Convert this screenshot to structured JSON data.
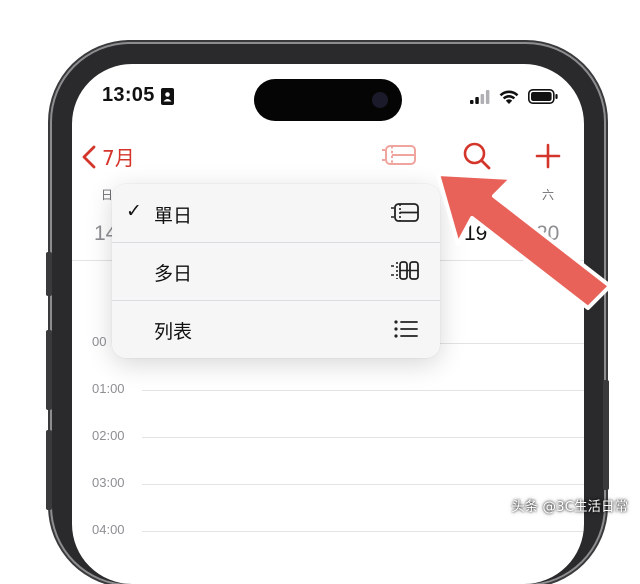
{
  "status_bar": {
    "time": "13:05",
    "icons": [
      "contact-card-icon",
      "signal-icon",
      "wifi-icon",
      "battery-icon"
    ]
  },
  "nav": {
    "back_label": "7月",
    "icons": [
      "day-view-icon",
      "search-icon",
      "plus-icon"
    ],
    "accent_color": "#d4352b"
  },
  "week": {
    "weekday_first": "日",
    "weekday_last": "六",
    "day_first": "14",
    "day_selected": "19",
    "day_last": "20"
  },
  "menu": {
    "items": [
      {
        "label": "單日",
        "checked": true,
        "icon": "single-day-icon"
      },
      {
        "label": "多日",
        "checked": false,
        "icon": "multi-day-icon"
      },
      {
        "label": "列表",
        "checked": false,
        "icon": "list-icon"
      }
    ],
    "check_mark": "✓"
  },
  "timeline": {
    "partial_hour": "00",
    "hours": [
      "01:00",
      "02:00",
      "03:00",
      "04:00"
    ]
  },
  "annotation": {
    "arrow_color": "#e8625a"
  },
  "watermark": "头条 @3C生活日常"
}
